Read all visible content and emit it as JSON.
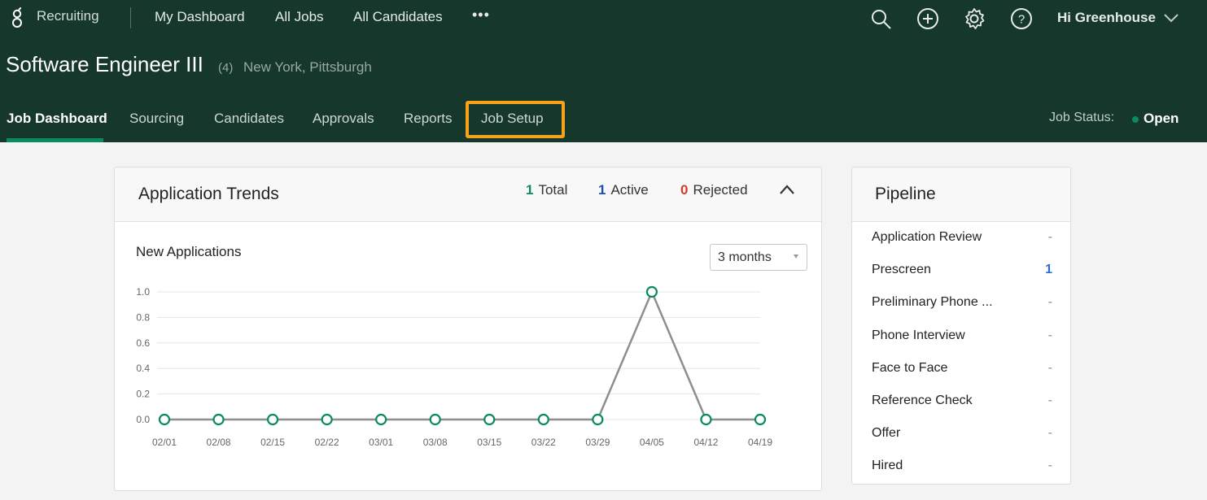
{
  "topnav": {
    "brand": "Recruiting",
    "links": [
      "My Dashboard",
      "All Jobs",
      "All Candidates"
    ],
    "more": "•••",
    "icons": [
      "search-icon",
      "add-icon",
      "settings-gear-icon",
      "help-icon"
    ],
    "greeting": "Hi Greenhouse"
  },
  "job": {
    "title": "Software Engineer III",
    "count": "(4)",
    "locations": "New York, Pittsburgh",
    "status_label": "Job Status:",
    "status_value": "Open",
    "status_color": "#0b8a62"
  },
  "subnav": {
    "tabs": [
      "Job Dashboard",
      "Sourcing",
      "Candidates",
      "Approvals",
      "Reports",
      "Job Setup"
    ],
    "active": "Job Dashboard",
    "highlighted": "Job Setup",
    "highlight_color": "#f5a31a"
  },
  "trends": {
    "title": "Application Trends",
    "stats": [
      {
        "num": "1",
        "label": "Total",
        "color": "#0b8a62"
      },
      {
        "num": "1",
        "label": "Active",
        "color": "#1a4fb5"
      },
      {
        "num": "0",
        "label": "Rejected",
        "color": "#d63a2a"
      }
    ],
    "subtitle": "New Applications",
    "range": "3 months"
  },
  "chart_data": {
    "type": "line",
    "title": "New Applications",
    "x": [
      "02/01",
      "02/08",
      "02/15",
      "02/22",
      "03/01",
      "03/08",
      "03/15",
      "03/22",
      "03/29",
      "04/05",
      "04/12",
      "04/19"
    ],
    "series": [
      {
        "name": "New Applications",
        "values": [
          0,
          0,
          0,
          0,
          0,
          0,
          0,
          0,
          0,
          1,
          0,
          0
        ]
      }
    ],
    "yticks": [
      "0.0",
      "0.2",
      "0.4",
      "0.6",
      "0.8",
      "1.0"
    ],
    "ylim": [
      0,
      1
    ],
    "grid": true,
    "line_color": "#8e8e8e",
    "marker_color": "#0b8a62",
    "xlabel": "",
    "ylabel": ""
  },
  "pipeline": {
    "title": "Pipeline",
    "stages": [
      {
        "label": "Application Review",
        "count": "-"
      },
      {
        "label": "Prescreen",
        "count": "1"
      },
      {
        "label": "Preliminary Phone ...",
        "count": "-"
      },
      {
        "label": "Phone Interview",
        "count": "-"
      },
      {
        "label": "Face to Face",
        "count": "-"
      },
      {
        "label": "Reference Check",
        "count": "-"
      },
      {
        "label": "Offer",
        "count": "-"
      },
      {
        "label": "Hired",
        "count": "-"
      }
    ]
  }
}
